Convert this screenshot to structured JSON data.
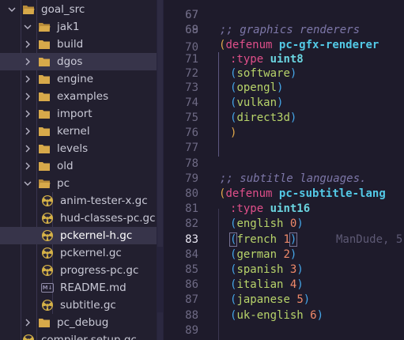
{
  "explorer": {
    "rows": [
      {
        "label": "goal_src",
        "kind": "folder",
        "expanded": true
      },
      {
        "label": "jak1",
        "kind": "folder",
        "expanded": true
      },
      {
        "label": "build",
        "kind": "folder",
        "expanded": false
      },
      {
        "label": "dgos",
        "kind": "folder",
        "expanded": false
      },
      {
        "label": "engine",
        "kind": "folder",
        "expanded": false
      },
      {
        "label": "examples",
        "kind": "folder",
        "expanded": false
      },
      {
        "label": "import",
        "kind": "folder",
        "expanded": false
      },
      {
        "label": "kernel",
        "kind": "folder",
        "expanded": false
      },
      {
        "label": "levels",
        "kind": "folder",
        "expanded": false
      },
      {
        "label": "old",
        "kind": "folder",
        "expanded": false
      },
      {
        "label": "pc",
        "kind": "folder",
        "expanded": true
      },
      {
        "label": "anim-tester-x.gc",
        "kind": "gc"
      },
      {
        "label": "hud-classes-pc.gc",
        "kind": "gc"
      },
      {
        "label": "pckernel-h.gc",
        "kind": "gc",
        "selected": true
      },
      {
        "label": "pckernel.gc",
        "kind": "gc"
      },
      {
        "label": "progress-pc.gc",
        "kind": "gc"
      },
      {
        "label": "README.md",
        "kind": "md"
      },
      {
        "label": "subtitle.gc",
        "kind": "gc"
      },
      {
        "label": "pc_debug",
        "kind": "folder",
        "expanded": false
      },
      {
        "label": "compiler-setup.gc",
        "kind": "gc"
      }
    ],
    "md_icon_text": "M↓"
  },
  "editor": {
    "line_numbers": [
      "67",
      "68",
      "69",
      "70",
      "71",
      "72",
      "73",
      "74",
      "75",
      "76",
      "77",
      "78",
      "79",
      "80",
      "81",
      "82",
      "83",
      "84",
      "85",
      "86",
      "87",
      "88",
      "89"
    ],
    "active_line": "83",
    "comment1": ";; graphics renderers",
    "defenum": "defenum",
    "enum1_name": "pc-gfx-renderer",
    "type_kw": ":type",
    "enum1_type": "uint8",
    "enum1_items": [
      "software",
      "opengl",
      "vulkan",
      "direct3d"
    ],
    "comment2": ";; subtitle languages.",
    "enum2_name": "pc-subtitle-lang",
    "enum2_type": "uint16",
    "enum2_items": [
      {
        "name": "english",
        "value": "0"
      },
      {
        "name": "french",
        "value": "1"
      },
      {
        "name": "german",
        "value": "2"
      },
      {
        "name": "spanish",
        "value": "3"
      },
      {
        "name": "italian",
        "value": "4"
      },
      {
        "name": "japanese",
        "value": "5"
      },
      {
        "name": "uk-english",
        "value": "6"
      }
    ],
    "blame": "ManDude, 5"
  },
  "colors": {
    "background": "#1e1b2b",
    "sidebar": "#221f2f",
    "gc_icon": "#d6b247",
    "folder": "#d7a94a"
  }
}
